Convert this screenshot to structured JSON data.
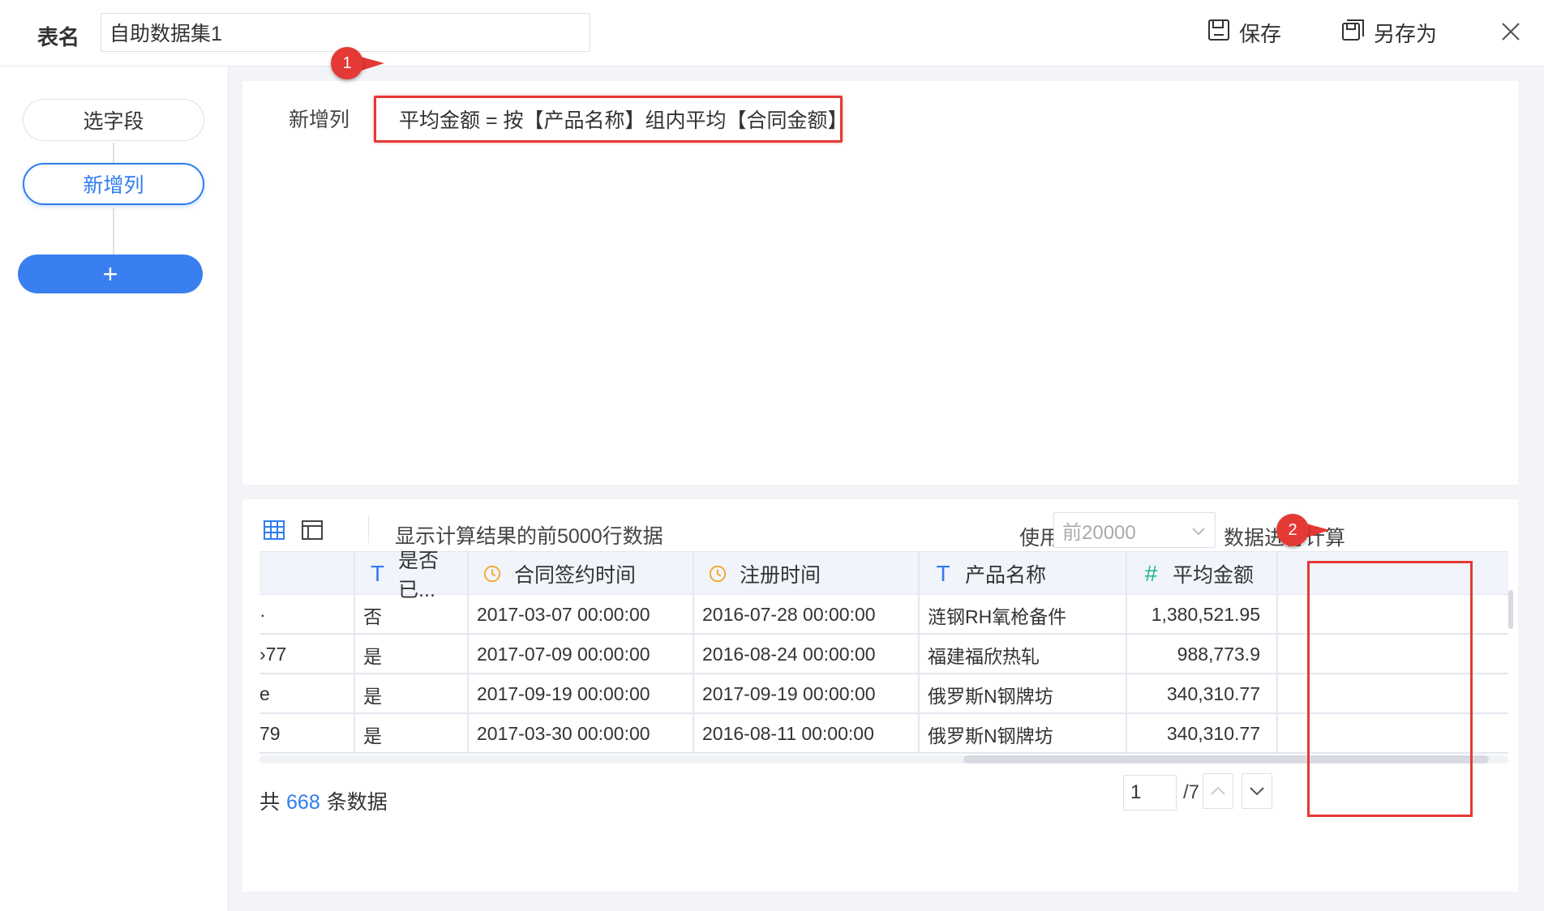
{
  "header": {
    "label": "表名",
    "table_name": "自助数据集1",
    "save_label": "保存",
    "save_as_label": "另存为"
  },
  "sidebar": {
    "steps": [
      {
        "label": "选字段",
        "active": false
      },
      {
        "label": "新增列",
        "active": true
      }
    ],
    "add_label": "+"
  },
  "formula": {
    "label": "新增列",
    "expression": "平均金额 = 按【产品名称】组内平均【合同金额】"
  },
  "preview": {
    "text": "显示计算结果的前5000行数据",
    "use_label": "使用",
    "rows_option": "前20000",
    "calc_label": "数据进行计算"
  },
  "table": {
    "columns": [
      {
        "label": "",
        "icon": ""
      },
      {
        "label": "是否已...",
        "icon": "text-type-icon"
      },
      {
        "label": "合同签约时间",
        "icon": "time-type-icon"
      },
      {
        "label": "注册时间",
        "icon": "time-type-icon"
      },
      {
        "label": "产品名称",
        "icon": "text-type-icon"
      },
      {
        "label": "平均金额",
        "icon": "number-type-icon"
      }
    ],
    "rows": [
      {
        "c0": "·",
        "c1": "否",
        "c2": "2017-03-07 00:00:00",
        "c3": "2016-07-28 00:00:00",
        "c4": "涟钢RH氧枪备件",
        "c5": "1,380,521.95"
      },
      {
        "c0": "›77",
        "c1": "是",
        "c2": "2017-07-09 00:00:00",
        "c3": "2016-08-24 00:00:00",
        "c4": "福建福欣热轧",
        "c5": "988,773.9"
      },
      {
        "c0": "e",
        "c1": "是",
        "c2": "2017-09-19 00:00:00",
        "c3": "2017-09-19 00:00:00",
        "c4": "俄罗斯N钢牌坊",
        "c5": "340,310.77"
      },
      {
        "c0": "79",
        "c1": "是",
        "c2": "2017-03-30 00:00:00",
        "c3": "2016-08-11 00:00:00",
        "c4": "俄罗斯N钢牌坊",
        "c5": "340,310.77"
      }
    ]
  },
  "footer": {
    "total_prefix": "共",
    "total_count": "668",
    "total_suffix": "条数据",
    "current_page": "1",
    "page_total": "/7"
  },
  "callouts": [
    "1",
    "2"
  ],
  "colors": {
    "accent": "#2f7cf0",
    "highlight": "#e53935",
    "header_bg": "#f1f4fb",
    "time_icon": "#f5a623",
    "number_icon": "#1ab394"
  }
}
